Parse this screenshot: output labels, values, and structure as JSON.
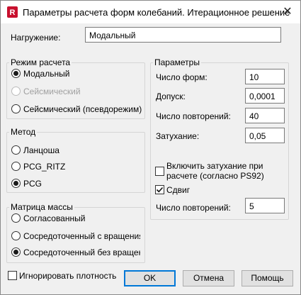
{
  "window": {
    "title": "Параметры расчета форм колебаний. Итерационное решение",
    "app_icon_letter": "R",
    "close_glyph": "✕"
  },
  "load": {
    "label": "Нагружение:",
    "value": "Модальный"
  },
  "calc_mode": {
    "title": "Режим расчета",
    "options": [
      {
        "label": "Модальный",
        "selected": true,
        "disabled": false
      },
      {
        "label": "Сейсмический",
        "selected": false,
        "disabled": true
      },
      {
        "label": "Сейсмический (псевдорежим)",
        "selected": false,
        "disabled": false
      }
    ]
  },
  "method": {
    "title": "Метод",
    "options": [
      {
        "label": "Ланцоша",
        "selected": false
      },
      {
        "label": "PCG_RITZ",
        "selected": false
      },
      {
        "label": "PCG",
        "selected": true
      }
    ]
  },
  "mass_matrix": {
    "title": "Матрица массы",
    "options": [
      {
        "label": "Согласованный",
        "selected": false
      },
      {
        "label": "Сосредоточенный с вращениями",
        "selected": false
      },
      {
        "label": "Сосредоточенный без вращения",
        "selected": true
      }
    ]
  },
  "params": {
    "title": "Параметры",
    "fields": [
      {
        "label": "Число форм:",
        "value": "10"
      },
      {
        "label": "Допуск:",
        "value": "0,0001"
      },
      {
        "label": "Число повторений:",
        "value": "40"
      },
      {
        "label": "Затухание:",
        "value": "0,05"
      }
    ],
    "damping_check": {
      "label_line1": "Включить затухание при",
      "label_line2": "расчете (согласно PS92)",
      "checked": false
    },
    "shift_check": {
      "label": "Сдвиг",
      "checked": true
    },
    "repeat2": {
      "label": "Число повторений:",
      "value": "5"
    }
  },
  "ignore_density": {
    "label": "Игнорировать плотность",
    "checked": false
  },
  "buttons": {
    "ok": "OK",
    "cancel": "Отмена",
    "help": "Помощь"
  }
}
